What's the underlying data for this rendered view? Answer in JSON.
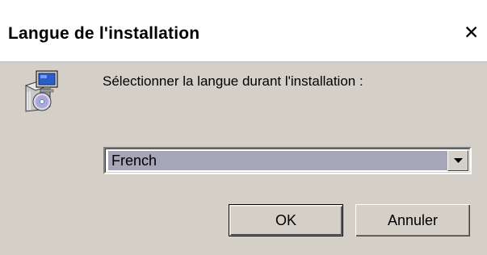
{
  "window": {
    "title": "Langue de l'installation",
    "close_label": "✕"
  },
  "icon": {
    "name": "setup-installer-icon"
  },
  "prompt": {
    "text": "Sélectionner la langue durant l'installation :"
  },
  "language_select": {
    "value": "French"
  },
  "buttons": {
    "ok_label": "OK",
    "cancel_label": "Annuler"
  },
  "colors": {
    "dialog_bg": "#d4d0c8",
    "titlebar_bg": "#ffffff",
    "selection_bg": "#a6a6b8"
  }
}
